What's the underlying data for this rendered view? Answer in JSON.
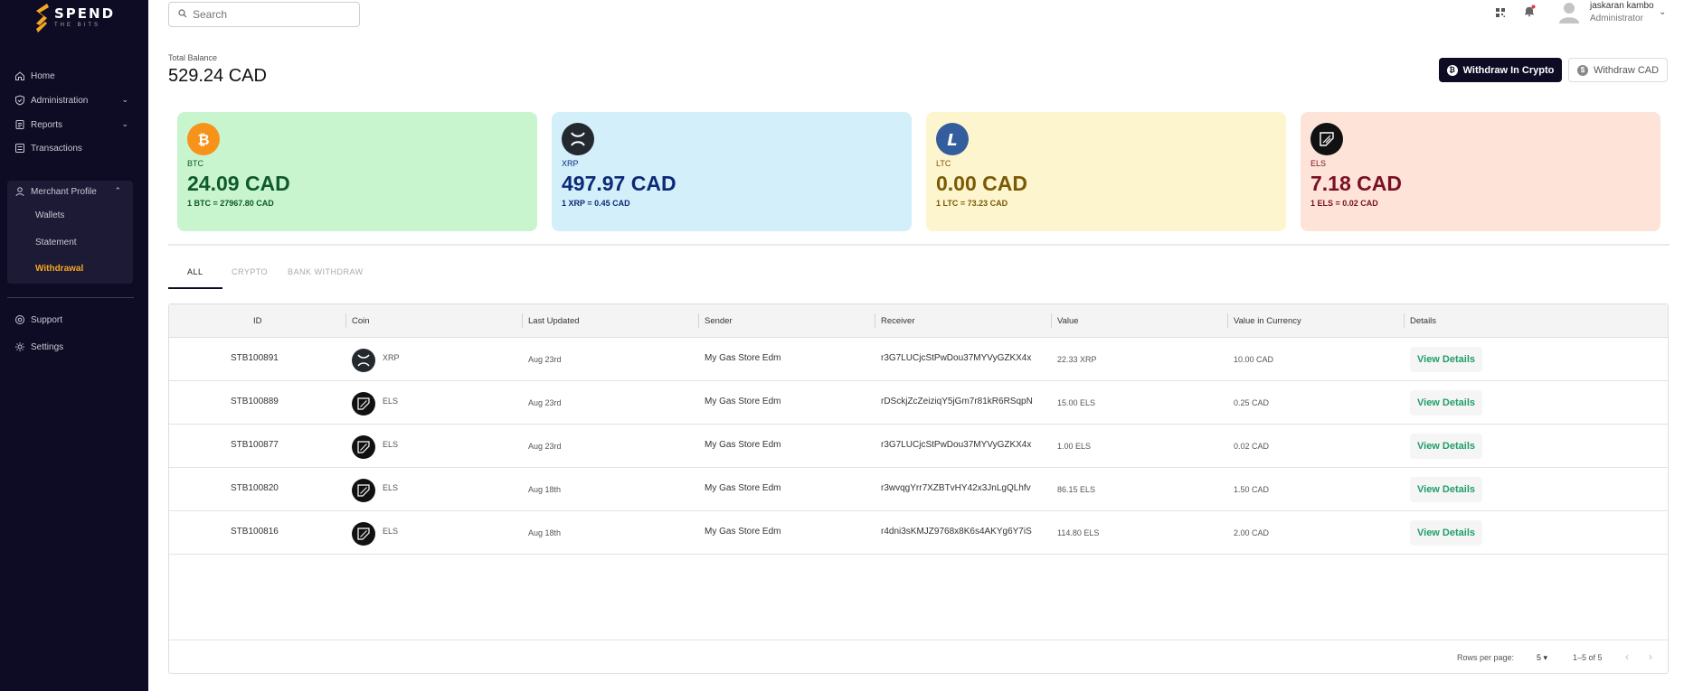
{
  "brand": {
    "word": "SPEND",
    "sub": "THE BITS",
    "accent": "#f6a623"
  },
  "sidebar": {
    "items": [
      {
        "label": "Home",
        "icon": "home-icon"
      },
      {
        "label": "Administration",
        "icon": "shield-check-icon"
      },
      {
        "label": "Reports",
        "icon": "report-icon"
      },
      {
        "label": "Transactions",
        "icon": "transactions-icon"
      },
      {
        "label": "Merchant Profile",
        "icon": "user-icon"
      }
    ],
    "sub_items": [
      "Wallets",
      "Statement",
      "Withdrawal"
    ],
    "bottom_items": [
      {
        "label": "Support",
        "icon": "support-icon"
      },
      {
        "label": "Settings",
        "icon": "settings-icon"
      }
    ]
  },
  "header": {
    "search_placeholder": "Search",
    "user_name": "jaskaran kambo",
    "user_role": "Administrator"
  },
  "balance": {
    "label": "Total Balance",
    "value": "529.24 CAD",
    "withdraw_crypto": "Withdraw In Crypto",
    "withdraw_cad": "Withdraw CAD"
  },
  "cards": [
    {
      "symbol": "BTC",
      "amount": "24.09 CAD",
      "rate": "1 BTC = 27967.80 CAD",
      "bg": "#c8f5cd",
      "fg": "#0f5a2c",
      "icon_bg": "#f7931a"
    },
    {
      "symbol": "XRP",
      "amount": "497.97 CAD",
      "rate": "1 XRP = 0.45 CAD",
      "bg": "#d3effa",
      "fg": "#0c2a78",
      "icon_bg": "#23292f"
    },
    {
      "symbol": "LTC",
      "amount": "0.00 CAD",
      "rate": "1 LTC = 73.23 CAD",
      "bg": "#fdf5cd",
      "fg": "#7a5a06",
      "icon_bg": "#345d9d"
    },
    {
      "symbol": "ELS",
      "amount": "7.18 CAD",
      "rate": "1 ELS = 0.02 CAD",
      "bg": "#fde3d8",
      "fg": "#7a1026",
      "icon_bg": "#111111"
    }
  ],
  "tabs": [
    "ALL",
    "CRYPTO",
    "BANK WITHDRAW"
  ],
  "table": {
    "columns": [
      "ID",
      "Coin",
      "Last Updated",
      "Sender",
      "Receiver",
      "Value",
      "Value in Currency",
      "Details"
    ],
    "rows": [
      {
        "id": "STB100891",
        "coin": "XRP",
        "date": "Aug 23rd",
        "sender": "My Gas Store Edm",
        "receiver": "r3G7LUCjcStPwDou37MYVyGZKX4x",
        "value": "22.33 XRP",
        "currency": "10.00 CAD",
        "action": "View Details"
      },
      {
        "id": "STB100889",
        "coin": "ELS",
        "date": "Aug 23rd",
        "sender": "My Gas Store Edm",
        "receiver": "rDSckjZcZeiziqY5jGm7r81kR6RSqpN",
        "value": "15.00 ELS",
        "currency": "0.25 CAD",
        "action": "View Details"
      },
      {
        "id": "STB100877",
        "coin": "ELS",
        "date": "Aug 23rd",
        "sender": "My Gas Store Edm",
        "receiver": "r3G7LUCjcStPwDou37MYVyGZKX4x",
        "value": "1.00 ELS",
        "currency": "0.02 CAD",
        "action": "View Details"
      },
      {
        "id": "STB100820",
        "coin": "ELS",
        "date": "Aug 18th",
        "sender": "My Gas Store Edm",
        "receiver": "r3wvqgYrr7XZBTvHY42x3JnLgQLhfv",
        "value": "86.15 ELS",
        "currency": "1.50 CAD",
        "action": "View Details"
      },
      {
        "id": "STB100816",
        "coin": "ELS",
        "date": "Aug 18th",
        "sender": "My Gas Store Edm",
        "receiver": "r4dni3sKMJZ9768x8K6s4AKYg6Y7iS",
        "value": "114.80 ELS",
        "currency": "2.00 CAD",
        "action": "View Details"
      }
    ],
    "rows_per_page_label": "Rows per page:",
    "rows_per_page": "5",
    "range": "1–5 of 5"
  }
}
